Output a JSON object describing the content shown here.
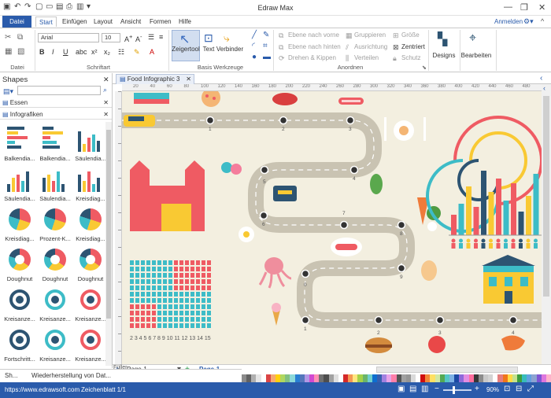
{
  "app_title": "Edraw Max",
  "menu": {
    "file": "Datei",
    "items": [
      "Start",
      "Einfügen",
      "Layout",
      "Ansicht",
      "Formen",
      "Hilfe"
    ],
    "signin": "Anmelden"
  },
  "ribbon": {
    "font_name": "Arial",
    "font_size": "10",
    "group_file": "Datei",
    "group_font": "Schriftart",
    "group_tools": "Basis Werkzeuge",
    "group_arrange": "Anordnen",
    "select_tool": "Zeigertool",
    "text_tool": "Text",
    "connector_tool": "Verbinder",
    "arrange": {
      "bring_forward": "Ebene nach vorne",
      "send_backward": "Ebene nach hinten",
      "rotate_flip": "Drehen & Kippen",
      "group": "Gruppieren",
      "align": "Ausrichtung",
      "distribute": "Verteilen",
      "size": "Größe",
      "center": "Zentriert",
      "protect": "Schutz"
    },
    "styles": "Designs",
    "edit": "Bearbeiten"
  },
  "shapes_panel": {
    "title": "Shapes",
    "search_placeholder": "",
    "categories": [
      "Essen",
      "Infografiken"
    ],
    "tiles": [
      "Balkendia...",
      "Balkendia...",
      "Säulendia...",
      "Säulendia...",
      "Säulendia...",
      "Kreisdiag...",
      "Kreisdiag...",
      "Prozent-K...",
      "Kreisdiag...",
      "Doughnut",
      "Doughnut",
      "Doughnut",
      "Kreisanze...",
      "Kreisanze...",
      "Kreisanze...",
      "Fortschritt...",
      "Kreisanze...",
      "Kreisanze..."
    ]
  },
  "document": {
    "tab": "Food Infographic 3",
    "canvas_numbers": [
      "1",
      "2",
      "3",
      "4",
      "5",
      "6",
      "7",
      "8",
      "9",
      "0",
      "1",
      "2",
      "3",
      "4"
    ],
    "legend_numbers": "2 3 4 5 6 7 8 9 10 11 12 13 14 15"
  },
  "ruler_marks": [
    "20",
    "40",
    "60",
    "80",
    "100",
    "120",
    "140",
    "160",
    "180",
    "200",
    "220",
    "240",
    "260",
    "280",
    "300",
    "320",
    "340",
    "360",
    "380",
    "400",
    "420",
    "440",
    "460",
    "480"
  ],
  "page_tabs": {
    "first": "Page-1",
    "current": "Page-1"
  },
  "bottom_panel": {
    "tab1": "Sh...",
    "tab2": "Wiederherstellung von Dat...",
    "fill_label": "Füller"
  },
  "status": {
    "url": "https://www.edrawsoft.com",
    "sheet": "Zeichenblatt 1/1",
    "zoom": "90%"
  },
  "colors": {
    "accent": "#2a5bab",
    "canvas_bg": "#f3efe0",
    "road": "#c9c3b2",
    "red": "#ef5b63",
    "teal": "#3dbcc7",
    "yellow": "#f9c933",
    "navy": "#2d5472"
  }
}
